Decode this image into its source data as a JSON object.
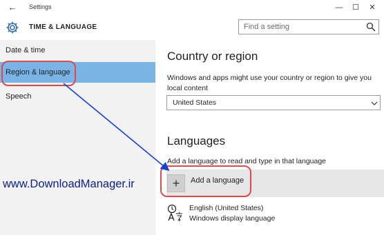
{
  "window": {
    "title": "Settings",
    "back_glyph": "←",
    "minimize_glyph": "—",
    "maximize_glyph": "☐",
    "close_glyph": "✕"
  },
  "header": {
    "title": "TIME & LANGUAGE",
    "icon": "gear-icon"
  },
  "search": {
    "placeholder": "Find a setting",
    "icon": "search-icon"
  },
  "sidebar": {
    "items": [
      {
        "label": "Date & time",
        "selected": false
      },
      {
        "label": "Region & language",
        "selected": true
      },
      {
        "label": "Speech",
        "selected": false
      }
    ]
  },
  "main": {
    "country": {
      "heading": "Country or region",
      "description": "Windows and apps might use your country or region to give you local content",
      "selected_value": "United States"
    },
    "languages": {
      "heading": "Languages",
      "description": "Add a language to read and type in that language",
      "add_glyph": "+",
      "add_label": "Add a language",
      "items": [
        {
          "name": "English (United States)",
          "subtitle": "Windows display language",
          "icon": "language-icon"
        }
      ]
    }
  },
  "annotation": {
    "watermark": "www.DownloadManager.ir",
    "colors": {
      "ring": "#e24848",
      "arrow": "#1a3fd8",
      "selection": "#7ab3e5",
      "sidebar_bg": "#f2f2f2"
    }
  }
}
